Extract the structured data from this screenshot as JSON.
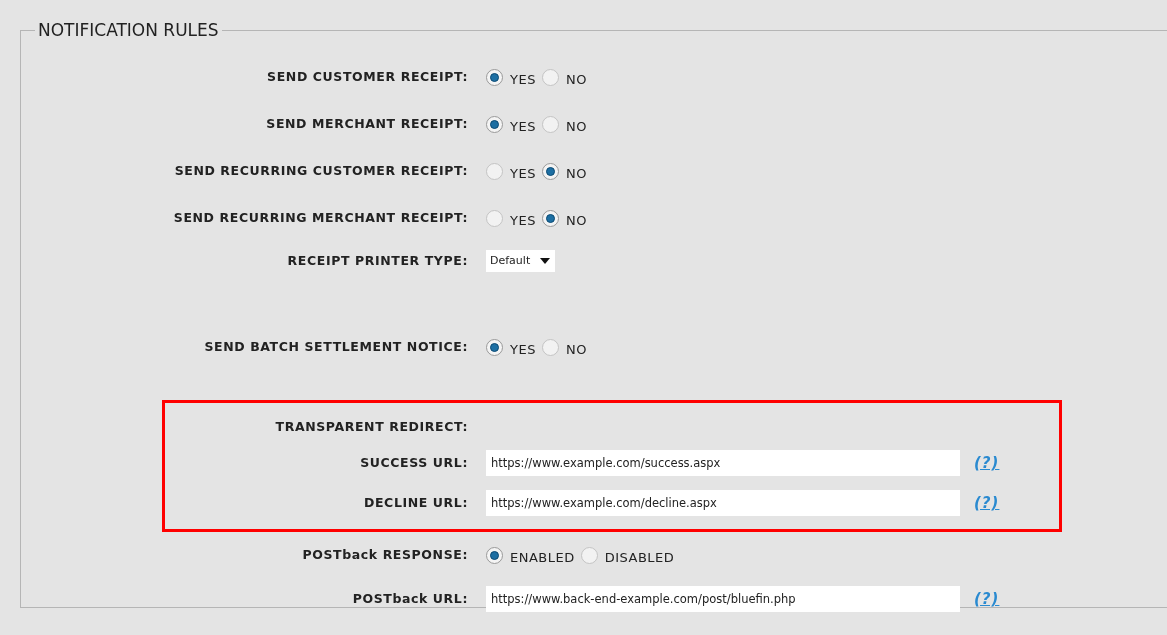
{
  "fieldset": {
    "legend": "NOTIFICATION RULES"
  },
  "sections": [
    {
      "highlighted": false,
      "rows": [
        {
          "kind": "radio",
          "label": "SEND CUSTOMER RECEIPT:",
          "options": [
            {
              "label": "YES",
              "selected": true
            },
            {
              "label": "NO",
              "selected": false
            }
          ]
        },
        {
          "kind": "radio",
          "label": "SEND MERCHANT RECEIPT:",
          "options": [
            {
              "label": "YES",
              "selected": true
            },
            {
              "label": "NO",
              "selected": false
            }
          ]
        },
        {
          "kind": "radio",
          "label": "SEND RECURRING CUSTOMER RECEIPT:",
          "options": [
            {
              "label": "YES",
              "selected": false
            },
            {
              "label": "NO",
              "selected": true
            }
          ]
        },
        {
          "kind": "radio",
          "label": "SEND RECURRING MERCHANT RECEIPT:",
          "options": [
            {
              "label": "YES",
              "selected": false
            },
            {
              "label": "NO",
              "selected": true
            }
          ]
        },
        {
          "kind": "select",
          "label": "RECEIPT PRINTER TYPE:",
          "value": "Default"
        }
      ]
    },
    {
      "highlighted": false,
      "rows": [
        {
          "kind": "radio",
          "label": "SEND BATCH SETTLEMENT NOTICE:",
          "options": [
            {
              "label": "YES",
              "selected": true
            },
            {
              "label": "NO",
              "selected": false
            }
          ]
        }
      ]
    },
    {
      "highlighted": true,
      "rows": [
        {
          "kind": "heading",
          "label": "TRANSPARENT REDIRECT:"
        },
        {
          "kind": "url",
          "label": "SUCCESS URL:",
          "value": "https://www.example.com/success.aspx",
          "help": "(?)"
        },
        {
          "kind": "url",
          "label": "DECLINE URL:",
          "value": "https://www.example.com/decline.aspx",
          "help": "(?)"
        }
      ]
    },
    {
      "highlighted": false,
      "rows": [
        {
          "kind": "radio",
          "label": "POSTback RESPONSE:",
          "options": [
            {
              "label": "ENABLED",
              "selected": true
            },
            {
              "label": "DISABLED",
              "selected": false
            }
          ]
        },
        {
          "kind": "url",
          "label": "POSTback URL:",
          "value": "https://www.back-end-example.com/post/bluefin.php",
          "help": "(?)"
        }
      ]
    }
  ]
}
